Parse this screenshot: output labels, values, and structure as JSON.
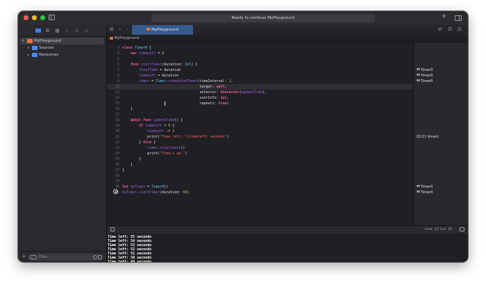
{
  "window": {
    "status_text": "Ready to continue MyPlayground"
  },
  "sidebar": {
    "nav_icons": [
      "folder-icon",
      "source-control-icon",
      "bookmark-icon",
      "find-icon",
      "issue-icon",
      "test-icon"
    ],
    "tree": [
      {
        "label": "MyPlayground",
        "expanded": true,
        "selected": true
      },
      {
        "label": "Sources",
        "expanded": false,
        "selected": false
      },
      {
        "label": "Resources",
        "expanded": false,
        "selected": false
      }
    ],
    "filter_placeholder": "Filter"
  },
  "editor": {
    "tab_label": "MyPlayground",
    "breadcrumb": "MyPlayground",
    "current_line": 12,
    "line_col": "Line: 12  Col: 19",
    "code_lines": [
      {
        "n": "3",
        "code": "class Timer0 {"
      },
      {
        "n": "4",
        "code": "    var timeLeft = 0"
      },
      {
        "n": "5",
        "code": ""
      },
      {
        "n": "6",
        "code": "    func startTimer(duration: Int) {"
      },
      {
        "n": "7",
        "code": "        totalTime = duration"
      },
      {
        "n": "8",
        "code": "        timeLeft = duration"
      },
      {
        "n": "9",
        "code": "        timer = Timer.scheduledTimer(timeInterval: 1,"
      },
      {
        "n": "12",
        "code": "                                     target: self,"
      },
      {
        "n": "13",
        "code": "                                     selector: #selector(updateTime),"
      },
      {
        "n": "14",
        "code": "                                     userInfo: nil,"
      },
      {
        "n": "15",
        "code": "                                     repeats: true)"
      },
      {
        "n": "16",
        "code": "    }"
      },
      {
        "n": "17",
        "code": ""
      },
      {
        "n": "18",
        "code": "    @objc func updateTime() {"
      },
      {
        "n": "19",
        "code": "        if timeLeft > 0 {"
      },
      {
        "n": "20",
        "code": "            timeLeft -= 1"
      },
      {
        "n": "21",
        "code": "            print(\"Time left: \\(timeLeft) seconds\")"
      },
      {
        "n": "22",
        "code": "        } else {"
      },
      {
        "n": "23",
        "code": "            timer.invalidate()"
      },
      {
        "n": "24",
        "code": "            print(\"Time's up!\")"
      },
      {
        "n": "25",
        "code": "        }"
      },
      {
        "n": "26",
        "code": "    }"
      },
      {
        "n": "27",
        "code": "}"
      },
      {
        "n": "28",
        "code": ""
      },
      {
        "n": "29",
        "code": ""
      },
      {
        "n": "30",
        "code": "let myTimer = Timer0()"
      },
      {
        "n": "31",
        "code": "myTimer.startTimer(duration: 60)"
      }
    ],
    "results": [
      {
        "row": 4,
        "text": "Timer0"
      },
      {
        "row": 5,
        "text": "Timer0"
      },
      {
        "row": 6,
        "text": "Timer0"
      },
      {
        "row": 16,
        "text": "(11 times)"
      },
      {
        "row": 25,
        "text": "Timer0"
      },
      {
        "row": 26,
        "text": "Timer0"
      }
    ]
  },
  "console": {
    "lines": [
      "Time left: 55 seconds",
      "Time left: 54 seconds",
      "Time left: 53 seconds",
      "Time left: 52 seconds",
      "Time left: 51 seconds",
      "Time left: 50 seconds",
      "Time left: 49 seconds"
    ]
  }
}
